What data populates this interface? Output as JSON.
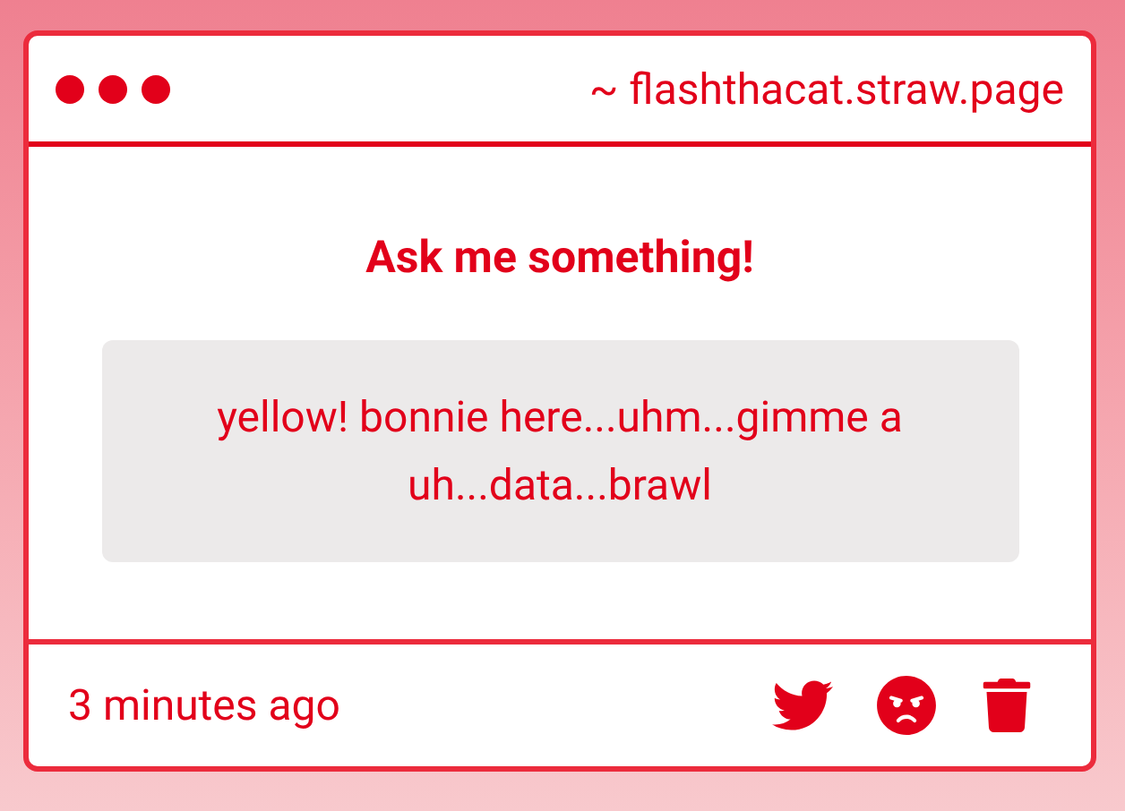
{
  "window": {
    "address": "~ flashthacat.straw.page"
  },
  "question": {
    "title": "Ask me something!",
    "text": "yellow! bonnie here...uhm...gimme a uh...data...brawl"
  },
  "footer": {
    "time": "3 minutes ago"
  }
}
